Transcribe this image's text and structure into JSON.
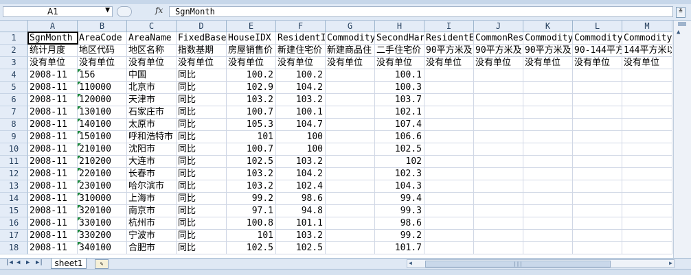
{
  "formula_bar": {
    "name_box": "A1",
    "fx_label": "fx",
    "content": "SgnMonth"
  },
  "columns": [
    "A",
    "B",
    "C",
    "D",
    "E",
    "F",
    "G",
    "H",
    "I",
    "J",
    "K",
    "L",
    "M"
  ],
  "row_numbers": [
    "1",
    "2",
    "3",
    "4",
    "5",
    "6",
    "7",
    "8",
    "9",
    "10",
    "11",
    "12",
    "13",
    "14",
    "15",
    "16",
    "17",
    "18"
  ],
  "rows": [
    [
      "SgnMonth",
      "AreaCode",
      "AreaName",
      "FixedBase",
      "HouseIDX",
      "ResidentI",
      "Commodity",
      "SecondHar",
      "ResidentE",
      "CommonRes",
      "Commodity",
      "Commodity",
      "Commodity"
    ],
    [
      "统计月度",
      "地区代码",
      "地区名称",
      "指数基期",
      "房屋销售价",
      "新建住宅价",
      "新建商品住",
      "二手住宅价",
      "90平方米及",
      "90平方米及",
      "90平方米及",
      "90-144平方",
      "144平方米以"
    ],
    [
      "没有单位",
      "没有单位",
      "没有单位",
      "没有单位",
      "没有单位",
      "没有单位",
      "没有单位",
      "没有单位",
      "没有单位",
      "没有单位",
      "没有单位",
      "没有单位",
      "没有单位"
    ],
    [
      "2008-11",
      "156",
      "中国",
      "同比",
      "100.2",
      "100.2",
      "",
      "100.1",
      "",
      "",
      "",
      "",
      ""
    ],
    [
      "2008-11",
      "110000",
      "北京市",
      "同比",
      "102.9",
      "104.2",
      "",
      "100.3",
      "",
      "",
      "",
      "",
      ""
    ],
    [
      "2008-11",
      "120000",
      "天津市",
      "同比",
      "103.2",
      "103.2",
      "",
      "103.7",
      "",
      "",
      "",
      "",
      ""
    ],
    [
      "2008-11",
      "130100",
      "石家庄市",
      "同比",
      "100.7",
      "100.1",
      "",
      "102.1",
      "",
      "",
      "",
      "",
      ""
    ],
    [
      "2008-11",
      "140100",
      "太原市",
      "同比",
      "105.3",
      "104.7",
      "",
      "107.4",
      "",
      "",
      "",
      "",
      ""
    ],
    [
      "2008-11",
      "150100",
      "呼和浩特市",
      "同比",
      "101",
      "100",
      "",
      "106.6",
      "",
      "",
      "",
      "",
      ""
    ],
    [
      "2008-11",
      "210100",
      "沈阳市",
      "同比",
      "100.7",
      "100",
      "",
      "102.5",
      "",
      "",
      "",
      "",
      ""
    ],
    [
      "2008-11",
      "210200",
      "大连市",
      "同比",
      "102.5",
      "103.2",
      "",
      "102",
      "",
      "",
      "",
      "",
      ""
    ],
    [
      "2008-11",
      "220100",
      "长春市",
      "同比",
      "103.2",
      "104.2",
      "",
      "102.3",
      "",
      "",
      "",
      "",
      ""
    ],
    [
      "2008-11",
      "230100",
      "哈尔滨市",
      "同比",
      "103.2",
      "102.4",
      "",
      "104.3",
      "",
      "",
      "",
      "",
      ""
    ],
    [
      "2008-11",
      "310000",
      "上海市",
      "同比",
      "99.2",
      "98.6",
      "",
      "99.4",
      "",
      "",
      "",
      "",
      ""
    ],
    [
      "2008-11",
      "320100",
      "南京市",
      "同比",
      "97.1",
      "94.8",
      "",
      "99.3",
      "",
      "",
      "",
      "",
      ""
    ],
    [
      "2008-11",
      "330100",
      "杭州市",
      "同比",
      "100.8",
      "101.1",
      "",
      "98.6",
      "",
      "",
      "",
      "",
      ""
    ],
    [
      "2008-11",
      "330200",
      "宁波市",
      "同比",
      "101",
      "103.2",
      "",
      "99.2",
      "",
      "",
      "",
      "",
      ""
    ],
    [
      "2008-11",
      "340100",
      "合肥市",
      "同比",
      "102.5",
      "102.5",
      "",
      "101.7",
      "",
      "",
      "",
      "",
      ""
    ]
  ],
  "sheet_tabs": [
    "sheet1"
  ],
  "colors": {
    "header_bg": "#e4ecf7",
    "grid_line": "#d0d7e5",
    "text_marker": "#1b8a3a"
  }
}
